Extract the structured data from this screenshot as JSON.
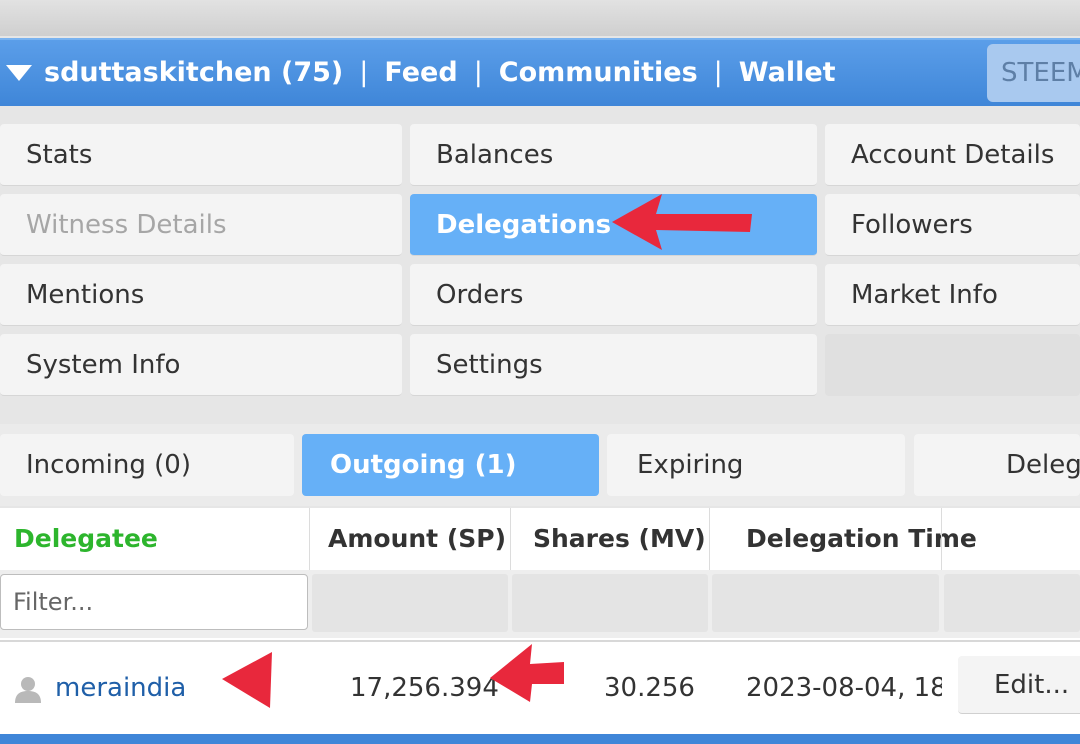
{
  "header": {
    "account": "sduttaskitchen (75)",
    "separator": "|",
    "nav": [
      "Feed",
      "Communities",
      "Wallet"
    ],
    "search_label": "STEEM"
  },
  "menu": {
    "items": [
      {
        "label": "Stats"
      },
      {
        "label": "Balances"
      },
      {
        "label": "Account Details"
      },
      {
        "label": "Witness Details",
        "state": "disabled"
      },
      {
        "label": "Delegations",
        "state": "active"
      },
      {
        "label": "Followers"
      },
      {
        "label": "Mentions"
      },
      {
        "label": "Orders"
      },
      {
        "label": "Market Info"
      },
      {
        "label": "System Info"
      },
      {
        "label": "Settings"
      }
    ]
  },
  "subtabs": {
    "items": [
      {
        "label": "Incoming (0)"
      },
      {
        "label": "Outgoing (1)",
        "state": "active"
      },
      {
        "label": "Expiring"
      },
      {
        "label": "Delegation Tools"
      }
    ]
  },
  "table": {
    "columns": [
      "Delegatee",
      "Amount (SP)",
      "Shares (MV)",
      "Delegation Time"
    ],
    "filter_placeholder": "Filter...",
    "rows": [
      {
        "delegatee": "meraindia",
        "amount": "17,256.394",
        "shares": "30.256",
        "time": "2023-08-04, 18:",
        "action": "Edit..."
      }
    ]
  },
  "colors": {
    "header_blue": "#4a8fde",
    "active_blue": "#66b0f7",
    "delegatee_green": "#2db52d",
    "link_blue": "#1f5fa8",
    "annotation_red": "#e8283c"
  }
}
